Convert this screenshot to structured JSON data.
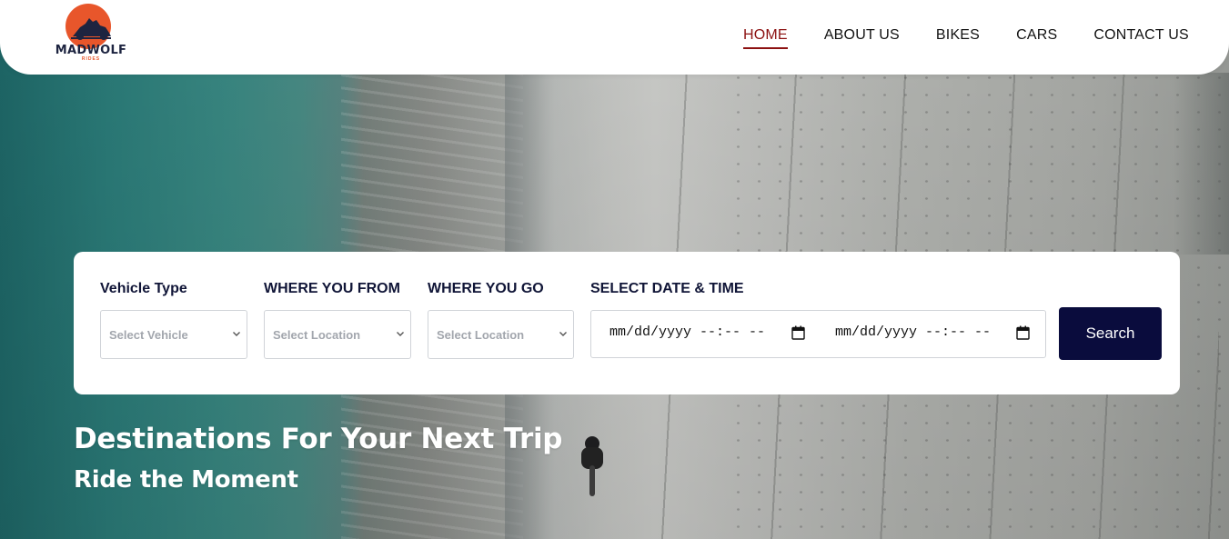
{
  "brand": {
    "name": "MADWOLF",
    "tagline": "RIDES",
    "accent": "#e8562b",
    "navy": "#1d2440"
  },
  "nav": {
    "items": [
      {
        "label": "HOME",
        "active": true
      },
      {
        "label": "ABOUT US",
        "active": false
      },
      {
        "label": "BIKES",
        "active": false
      },
      {
        "label": "CARS",
        "active": false
      },
      {
        "label": "CONTACT US",
        "active": false
      }
    ],
    "active_color": "#8c1111"
  },
  "search": {
    "vehicle": {
      "label": "Vehicle Type",
      "placeholder": "Select Vehicle"
    },
    "from": {
      "label": "WHERE YOU FROM",
      "placeholder": "Select Location"
    },
    "to": {
      "label": "WHERE YOU GO",
      "placeholder": "Select Location"
    },
    "date": {
      "label": "SELECT DATE & TIME",
      "start": "mm/dd/yyyy --:-- --",
      "end": "mm/dd/yyyy --:-- --"
    },
    "button_label": "Search",
    "button_color": "#0a0c3d"
  },
  "hero": {
    "title": "Destinations For Your Next Trip",
    "subtitle": "Ride the Moment"
  }
}
